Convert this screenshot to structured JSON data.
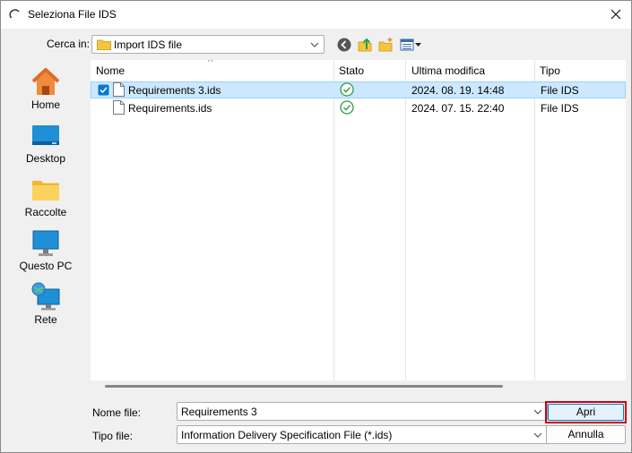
{
  "window": {
    "title": "Seleziona File IDS",
    "title_icon": "loading-arc-icon",
    "close_icon": "close-icon"
  },
  "toolbar": {
    "look_in_label": "Cerca in:",
    "look_in_value": "Import IDS file",
    "tools": [
      "back-icon",
      "up-folder-icon",
      "new-folder-icon",
      "view-menu-icon"
    ]
  },
  "places": [
    {
      "label": "Home",
      "icon": "home-icon"
    },
    {
      "label": "Desktop",
      "icon": "desktop-icon"
    },
    {
      "label": "Raccolte",
      "icon": "folder-icon"
    },
    {
      "label": "Questo PC",
      "icon": "computer-icon"
    },
    {
      "label": "Rete",
      "icon": "network-icon"
    }
  ],
  "file_list": {
    "columns": [
      "Nome",
      "Stato",
      "Ultima modifica",
      "Tipo"
    ],
    "sort_indicator": "^",
    "rows": [
      {
        "name": "Requirements 3.ids",
        "status_icon": "check-circle-icon",
        "modified": "2024. 08. 19. 14:48",
        "type": "File IDS",
        "selected": true
      },
      {
        "name": "Requirements.ids",
        "status_icon": "check-circle-icon",
        "modified": "2024. 07. 15. 22:40",
        "type": "File IDS",
        "selected": false
      }
    ]
  },
  "bottom": {
    "file_name_label": "Nome file:",
    "file_name_value": "Requirements 3",
    "file_type_label": "Tipo file:",
    "file_type_value": "Information Delivery Specification File (*.ids)",
    "open_button": "Apri",
    "cancel_button": "Annulla"
  },
  "colors": {
    "selection": "#cce8ff",
    "accent": "#0078d4",
    "highlight": "#d4000f",
    "check": "#2e9e44"
  }
}
